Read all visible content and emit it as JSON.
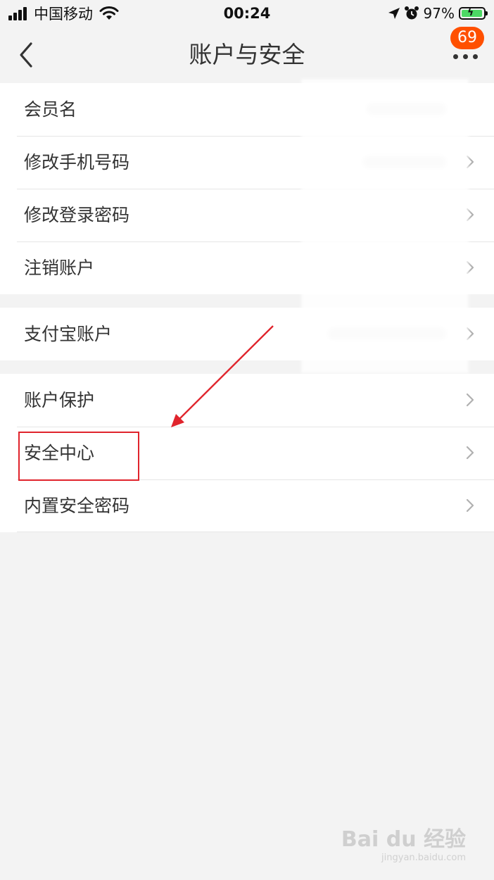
{
  "status_bar": {
    "carrier": "中国移动",
    "time": "00:24",
    "battery_percent": "97%"
  },
  "nav": {
    "title": "账户与安全",
    "badge_count": "69"
  },
  "groups": [
    {
      "items": [
        {
          "label": "会员名"
        },
        {
          "label": "修改手机号码"
        },
        {
          "label": "修改登录密码"
        },
        {
          "label": "注销账户"
        }
      ]
    },
    {
      "items": [
        {
          "label": "支付宝账户"
        }
      ]
    },
    {
      "items": [
        {
          "label": "账户保护"
        },
        {
          "label": "安全中心"
        },
        {
          "label": "内置安全密码"
        }
      ]
    }
  ],
  "annotation": {
    "highlight_color": "#e0242c",
    "highlighted_item": "安全中心"
  },
  "watermark": {
    "logo": "Bai du 经验",
    "sub": "jingyan.baidu.com"
  },
  "colors": {
    "badge": "#ff5000",
    "background": "#f3f3f3",
    "battery": "#4cd964"
  }
}
